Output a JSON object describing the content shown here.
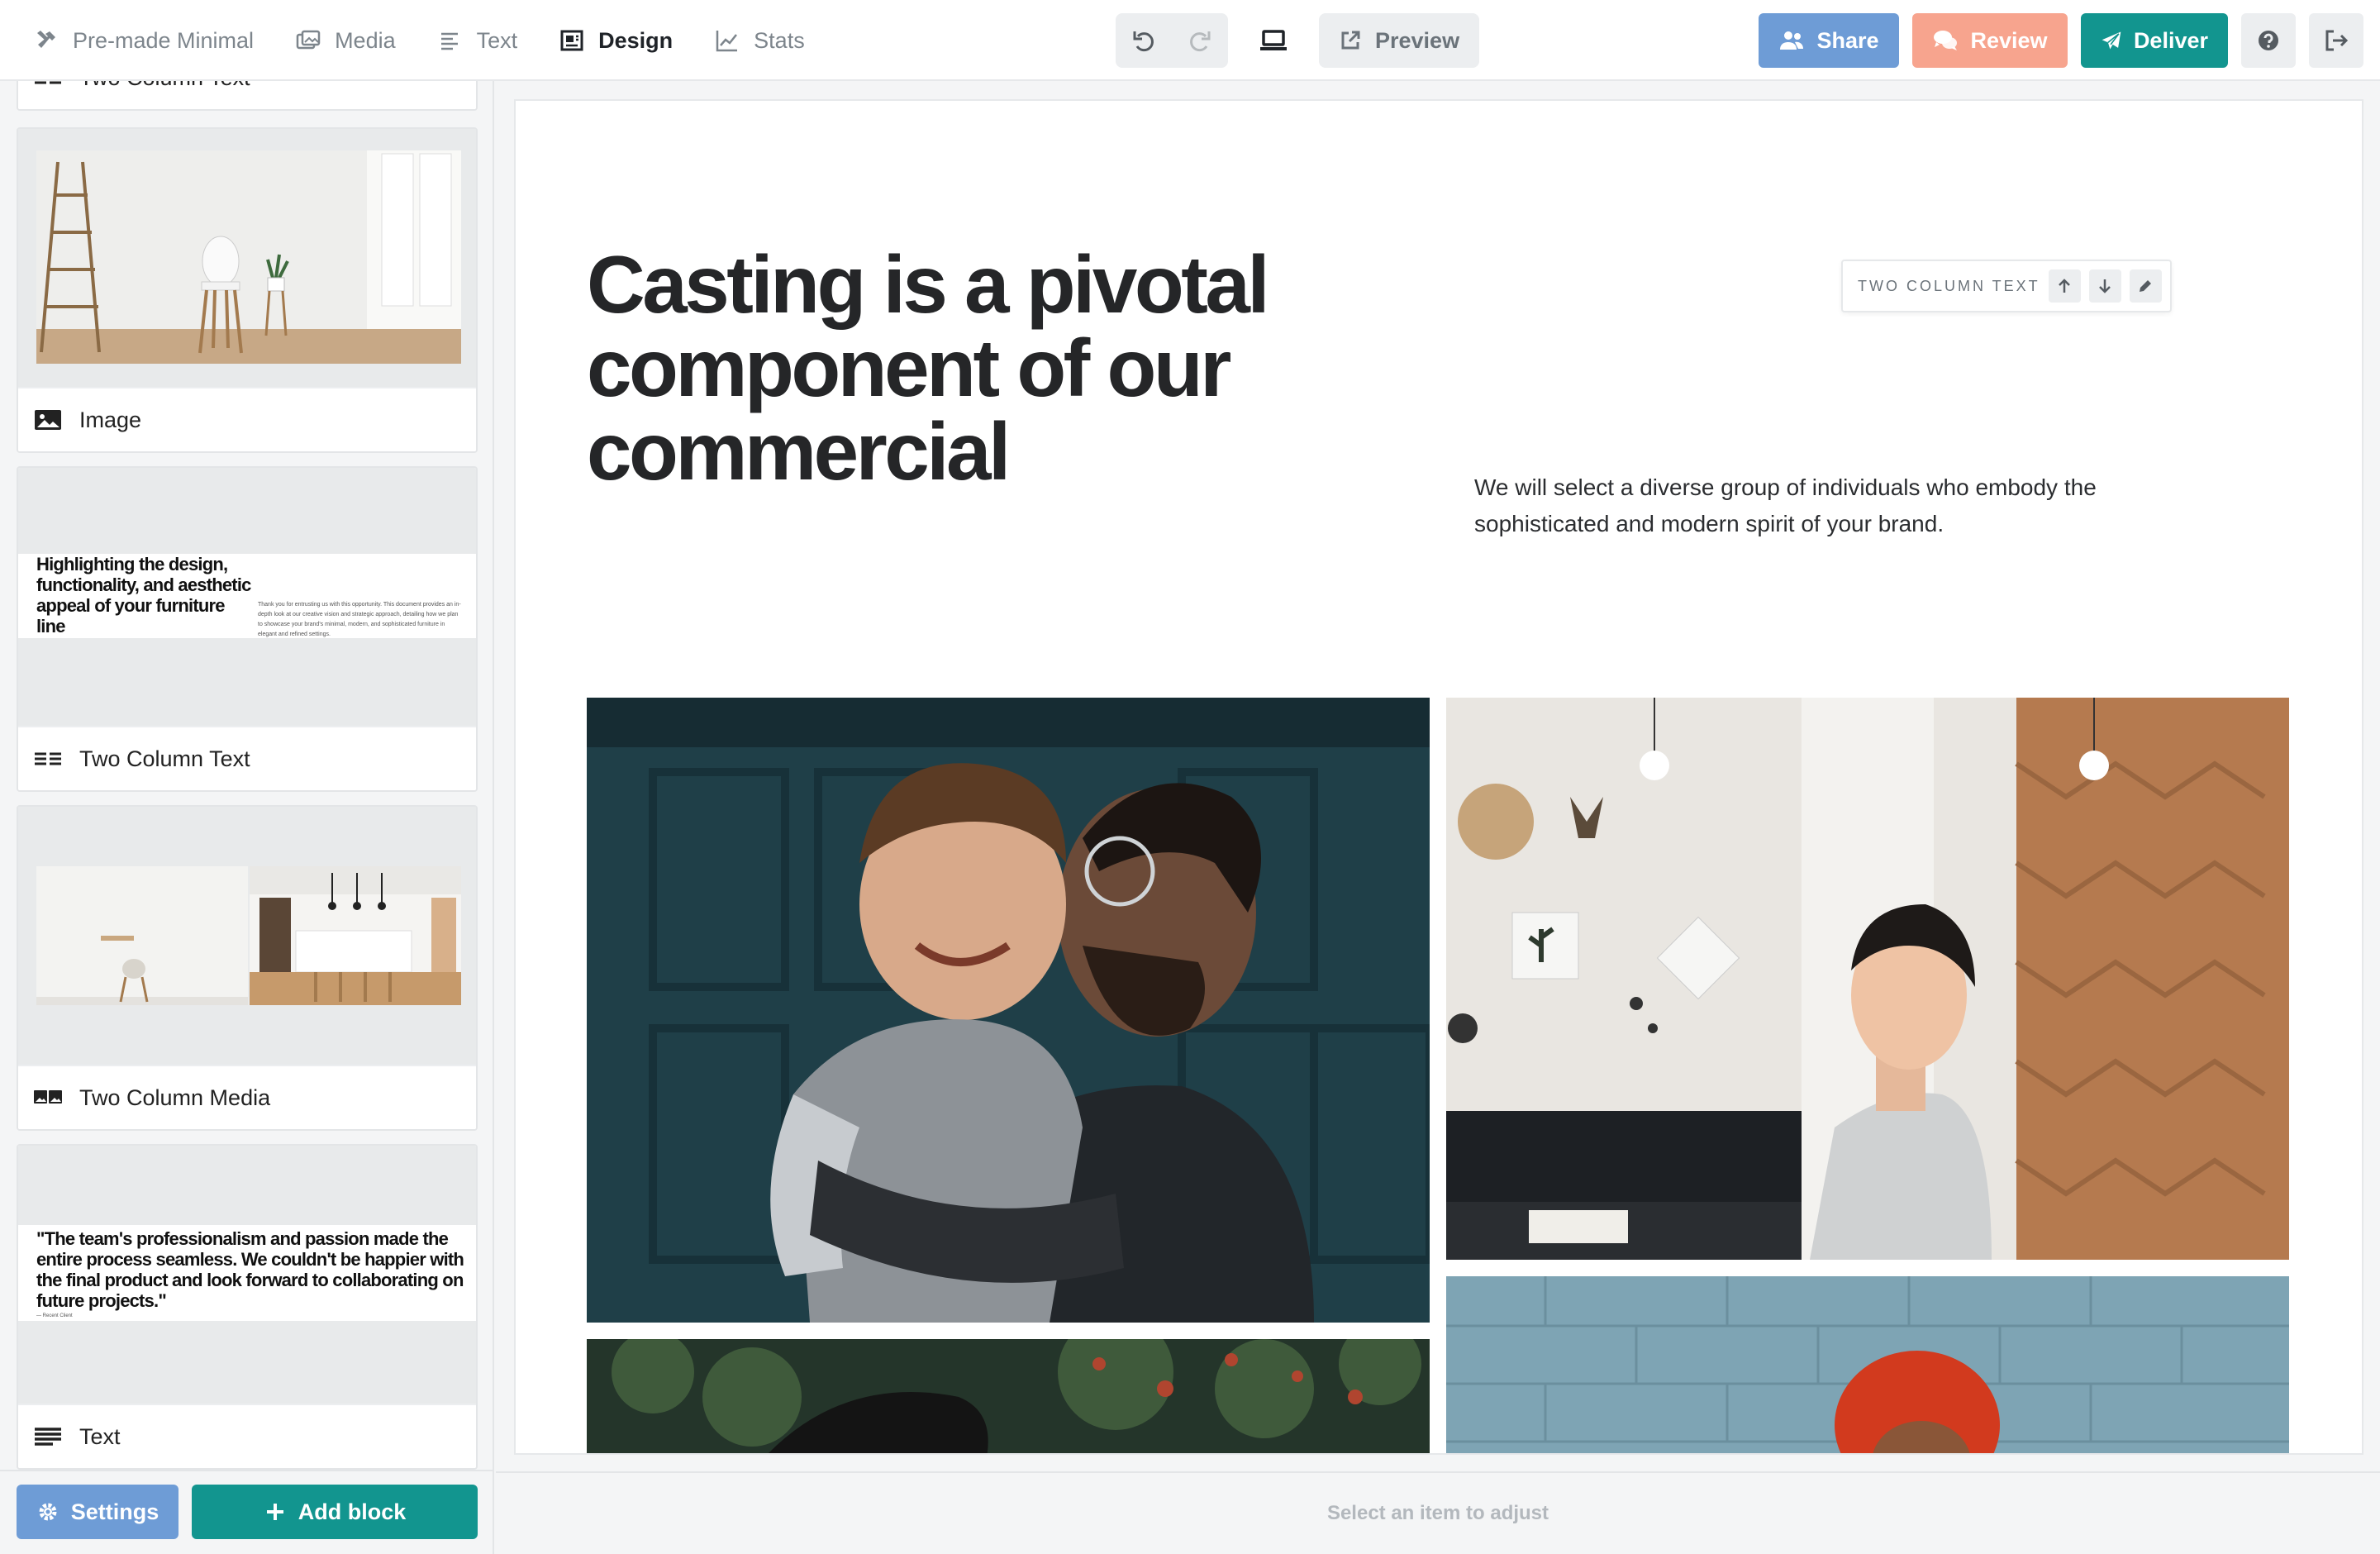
{
  "nav": {
    "items": [
      {
        "label": "Pre-made Minimal",
        "icon": "tools-icon"
      },
      {
        "label": "Media",
        "icon": "media-icon"
      },
      {
        "label": "Text",
        "icon": "text-icon"
      },
      {
        "label": "Design",
        "icon": "design-icon",
        "active": true
      },
      {
        "label": "Stats",
        "icon": "stats-icon"
      }
    ]
  },
  "toolbar": {
    "preview_label": "Preview"
  },
  "actions": {
    "share_label": "Share",
    "review_label": "Review",
    "deliver_label": "Deliver"
  },
  "sidebar": {
    "partial_label": "Two Column Text",
    "cards": [
      {
        "label": "Image",
        "icon": "image-icon"
      },
      {
        "label": "Two Column Text",
        "icon": "two-column-text-icon",
        "thumb_heading": "Highlighting the design, functionality, and aesthetic appeal of your furniture line",
        "thumb_body": "Thank you for entrusting us with this opportunity. This document provides an in-depth look at our creative vision and strategic approach, detailing how we plan to showcase your brand's minimal, modern, and sophisticated furniture in elegant and refined settings."
      },
      {
        "label": "Two Column Media",
        "icon": "two-column-media-icon"
      },
      {
        "label": "Text",
        "icon": "text-block-icon",
        "thumb_quote": "\"The team's professionalism and passion made the entire process seamless. We couldn't be happier with the final product and look forward to collaborating on future projects.\"",
        "thumb_attribution": "— Recent Client"
      }
    ],
    "settings_label": "Settings",
    "add_block_label": "Add block"
  },
  "page": {
    "headline": "Casting is a pivotal component of our commercial",
    "body": "We will select a diverse group of individuals who embody the sophisticated and modern spirit of your brand.",
    "block_toolbar_label": "TWO COLUMN TEXT"
  },
  "status": {
    "text": "Select an item to adjust"
  },
  "colors": {
    "share": "#6e9cd6",
    "review": "#f7a48e",
    "deliver": "#12958f",
    "settings": "#6e9cd6",
    "add_block": "#12958f"
  }
}
